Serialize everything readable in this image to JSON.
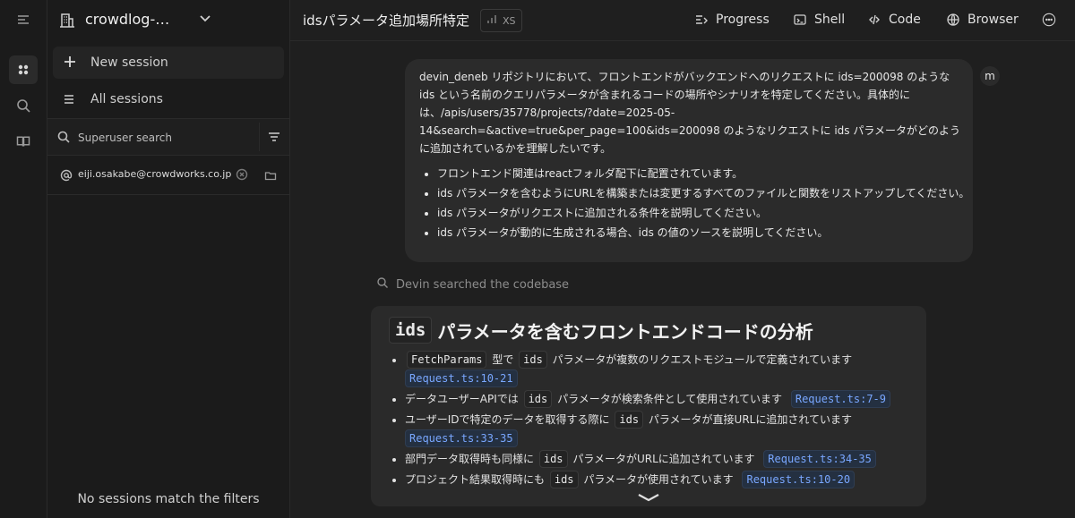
{
  "sidebar_rail": {
    "items": [
      {
        "name": "collapse-sidebar-icon"
      },
      {
        "name": "sessions-icon"
      },
      {
        "name": "search-icon"
      },
      {
        "name": "docs-book-icon"
      }
    ]
  },
  "panel": {
    "org_name": "crowdlog-…",
    "new_session_label": "New session",
    "all_sessions_label": "All sessions",
    "search_placeholder": "Superuser search",
    "filter_email": "eiji.osakabe@crowdworks.co.jp",
    "empty_state": "No sessions match the filters"
  },
  "topbar": {
    "title": "idsパラメータ追加場所特定",
    "size_badge": "XS",
    "actions": [
      "Progress",
      "Shell",
      "Code",
      "Browser"
    ]
  },
  "conversation": {
    "user_avatar": "m",
    "user_message": {
      "paragraph": "devin_deneb リポジトリにおいて、フロントエンドがバックエンドへのリクエストに ids=200098 のような ids という名前のクエリパラメータが含まれるコードの場所やシナリオを特定してください。具体的には、/apis/users/35778/projects/?date=2025-05-14&search=&active=true&per_page=100&ids=200098 のようなリクエストに ids パラメータがどのように追加されているかを理解したいです。",
      "bullets": [
        "フロントエンド関連はreactフォルダ配下に配置されています。",
        "ids パラメータを含むようにURLを構築または変更するすべてのファイルと関数をリストアップしてください。",
        "ids パラメータがリクエストに追加される条件を説明してください。",
        "ids パラメータが動的に生成される場合、ids の値のソースを説明してください。"
      ]
    },
    "status": "Devin searched the codebase",
    "answer": {
      "heading_code": "ids",
      "heading_text": "パラメータを含むフロントエンドコードの分析",
      "items": [
        {
          "code": "FetchParams",
          "text1": "型で",
          "code2": "ids",
          "text2": "パラメータが複数のリクエストモジュールで定義されています",
          "ref": "Request.ts:10-21"
        },
        {
          "text0": "データユーザーAPIでは",
          "code": "ids",
          "text1": "パラメータが検索条件として使用されています",
          "ref": "Request.ts:7-9"
        },
        {
          "text0": "ユーザーIDで特定のデータを取得する際に",
          "code": "ids",
          "text1": "パラメータが直接URLに追加されています",
          "ref": "Request.ts:33-35"
        },
        {
          "text0": "部門データ取得時も同様に",
          "code": "ids",
          "text1": "パラメータがURLに追加されています",
          "ref": "Request.ts:34-35"
        },
        {
          "text0": "プロジェクト結果取得時にも",
          "code": "ids",
          "text1": "パラメータが使用されています",
          "ref": "Request.ts:10-20"
        }
      ]
    }
  }
}
